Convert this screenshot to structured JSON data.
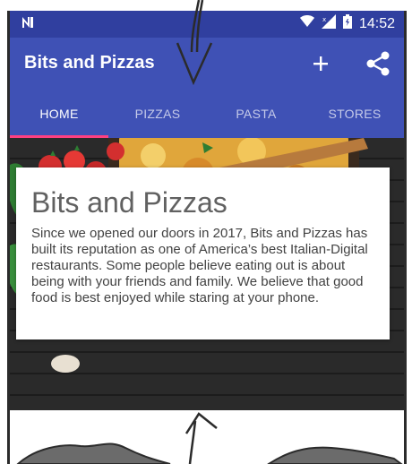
{
  "status_bar": {
    "left_icon": "n-notification-icon",
    "time": "14:52",
    "icons": [
      "wifi-icon",
      "signal-icon",
      "battery-icon"
    ]
  },
  "app_bar": {
    "title": "Bits and Pizzas",
    "actions": [
      "add-icon",
      "share-icon"
    ]
  },
  "tabs": [
    {
      "label": "HOME",
      "active": true
    },
    {
      "label": "PIZZAS",
      "active": false
    },
    {
      "label": "PASTA",
      "active": false
    },
    {
      "label": "STORES",
      "active": false
    }
  ],
  "card": {
    "title": "Bits and Pizzas",
    "body": "Since we opened our doors in 2017, Bits and Pizzas has built its reputation as one of America’s best Italian-Digital restaurants. Some people believe eating out is about being with your friends and family. We believe that good food is best enjoyed while staring at your phone."
  },
  "colors": {
    "primary": "#3f51b5",
    "primary_dark": "#303f9f",
    "accent": "#ff4081"
  }
}
